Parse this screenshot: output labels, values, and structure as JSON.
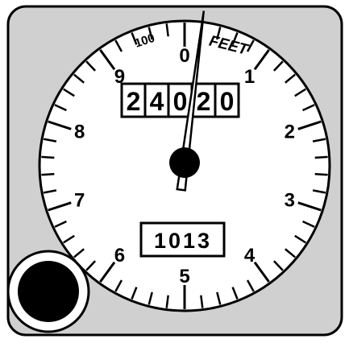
{
  "instrument": {
    "unit_label": "FEET",
    "hundreds_label": "100",
    "dial_numbers": [
      "0",
      "1",
      "2",
      "3",
      "4",
      "5",
      "6",
      "7",
      "8",
      "9"
    ],
    "altitude_counter": [
      "2",
      "4",
      "0",
      "2",
      "0"
    ],
    "pressure_setting": "1013",
    "pointer_reading_hundreds_feet": 0.2,
    "colors": {
      "case": "#d0d0d0",
      "dial_face": "#ffffff",
      "ink": "#000000"
    }
  },
  "knob": {
    "icon": "setting-knob-icon"
  }
}
